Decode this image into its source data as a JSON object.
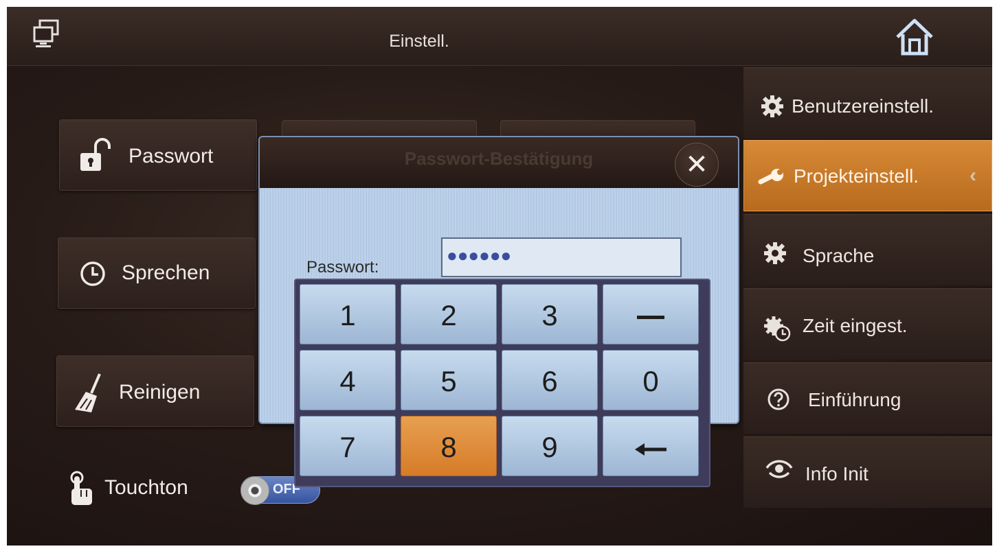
{
  "header": {
    "title": "Einstell.",
    "left_icon": "monitor-icon",
    "right_icon": "home-icon"
  },
  "left_menu": {
    "items": [
      {
        "label": "Passwort",
        "icon": "unlock-icon"
      },
      {
        "label": "Sprechen",
        "icon": "clock-icon"
      },
      {
        "label": "Reinigen",
        "icon": "broom-icon"
      }
    ],
    "touchton": {
      "label": "Touchton",
      "icon": "hand-touch-icon",
      "toggle_state": "OFF"
    }
  },
  "sidebar": {
    "items": [
      {
        "label": "Benutzereinstell.",
        "icon": "gear-icon",
        "active": false
      },
      {
        "label": "Projekteinstell.",
        "icon": "wrench-icon",
        "active": true
      },
      {
        "label": "Sprache",
        "icon": "gear-icon",
        "active": false
      },
      {
        "label": "Zeit eingest.",
        "icon": "gear-clock-icon",
        "active": false
      },
      {
        "label": "Einführung",
        "icon": "help-icon",
        "active": false
      },
      {
        "label": "Info Init",
        "icon": "eye-icon",
        "active": false
      }
    ]
  },
  "dialog": {
    "title": "Passwort-Bestätigung",
    "close_label": "✕",
    "password_label": "Passwort:",
    "password_value": "●●●●●●"
  },
  "keypad": {
    "keys": [
      "1",
      "2",
      "3",
      "—",
      "4",
      "5",
      "6",
      "0",
      "7",
      "8",
      "9",
      "←"
    ],
    "highlighted_key": "8"
  },
  "colors": {
    "accent": "#c8782a",
    "dialog_bg": "#b8cde6",
    "key_bg": "#b3c9e3",
    "background": "#271b17"
  }
}
